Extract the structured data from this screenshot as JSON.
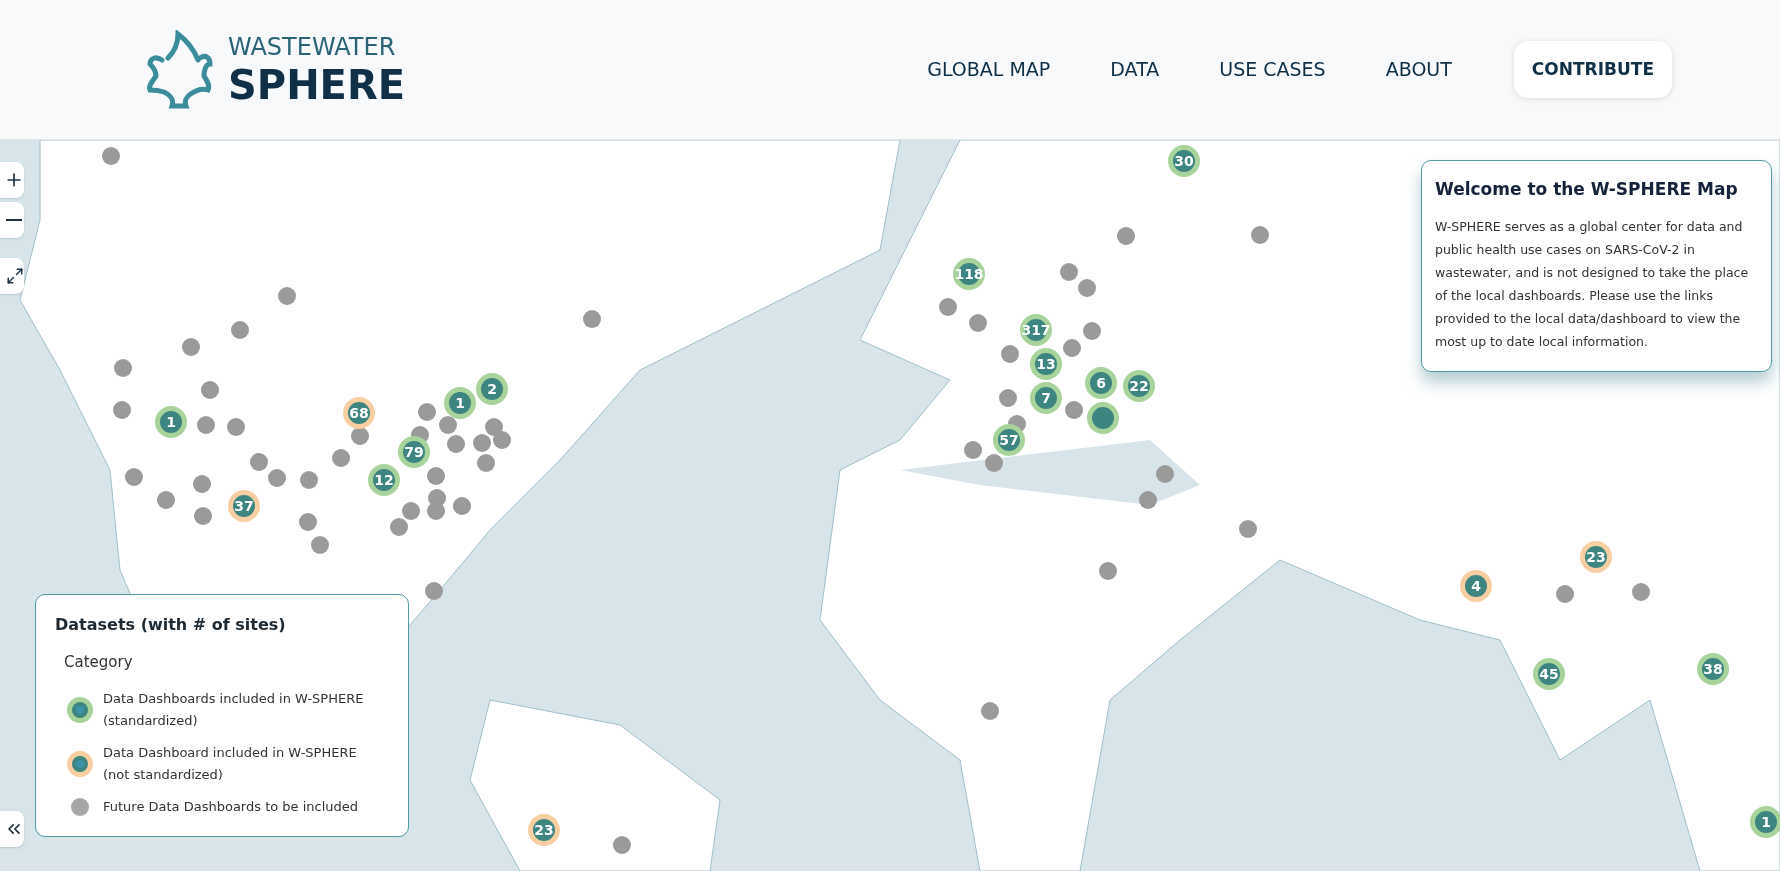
{
  "header": {
    "logo": {
      "line_1": "WASTEWATER",
      "line_2": "SPHERE"
    },
    "nav": [
      {
        "label": "GLOBAL MAP",
        "kind": "link"
      },
      {
        "label": "DATA",
        "kind": "link"
      },
      {
        "label": "USE CASES",
        "kind": "link"
      },
      {
        "label": "ABOUT",
        "kind": "link"
      },
      {
        "label": "CONTRIBUTE",
        "kind": "button"
      }
    ]
  },
  "map": {
    "markers": [
      {
        "kind": "standardized",
        "label": "30"
      },
      {
        "kind": "standardized",
        "label": "118"
      },
      {
        "kind": "standardized",
        "label": "317"
      },
      {
        "kind": "standardized",
        "label": "13"
      },
      {
        "kind": "standardized",
        "label": "7"
      },
      {
        "kind": "standardized",
        "label": "6"
      },
      {
        "kind": "standardized"
      },
      {
        "kind": "standardized",
        "label": "22"
      },
      {
        "kind": "standardized",
        "label": "57"
      },
      {
        "kind": "standardized",
        "label": "1"
      },
      {
        "kind": "standardized",
        "label": "1"
      },
      {
        "kind": "standardized",
        "label": "2"
      },
      {
        "kind": "standardized",
        "label": "79"
      },
      {
        "kind": "standardized",
        "label": "12"
      },
      {
        "kind": "standardized",
        "label": "45"
      },
      {
        "kind": "standardized",
        "label": "38"
      },
      {
        "kind": "standardized",
        "label": "1"
      },
      {
        "kind": "not_standardized",
        "label": "68"
      },
      {
        "kind": "not_standardized",
        "label": "37"
      },
      {
        "kind": "not_standardized",
        "label": "23"
      },
      {
        "kind": "not_standardized",
        "label": "4"
      },
      {
        "kind": "not_standardized",
        "label": "23"
      }
    ]
  },
  "welcome": {
    "title": "Welcome to the W-SPHERE Map",
    "text": "W-SPHERE serves as a global center for data and public health use cases on SARS-CoV-2 in wastewater, and is not designed to take the place of the local dashboards. Please use the links provided to the local data/dashboard to view the most up to date local information."
  },
  "legend": {
    "title": "Datasets (with # of sites)",
    "subtitle": "Category",
    "items": [
      {
        "kind": "standardized",
        "label": "Data Dashboards included in W-SPHERE (standardized)"
      },
      {
        "kind": "not_standardized",
        "label": "Data Dashboard included in W-SPHERE (not standardized)"
      },
      {
        "kind": "future",
        "label": "Future Data Dashboards to be included"
      }
    ]
  }
}
